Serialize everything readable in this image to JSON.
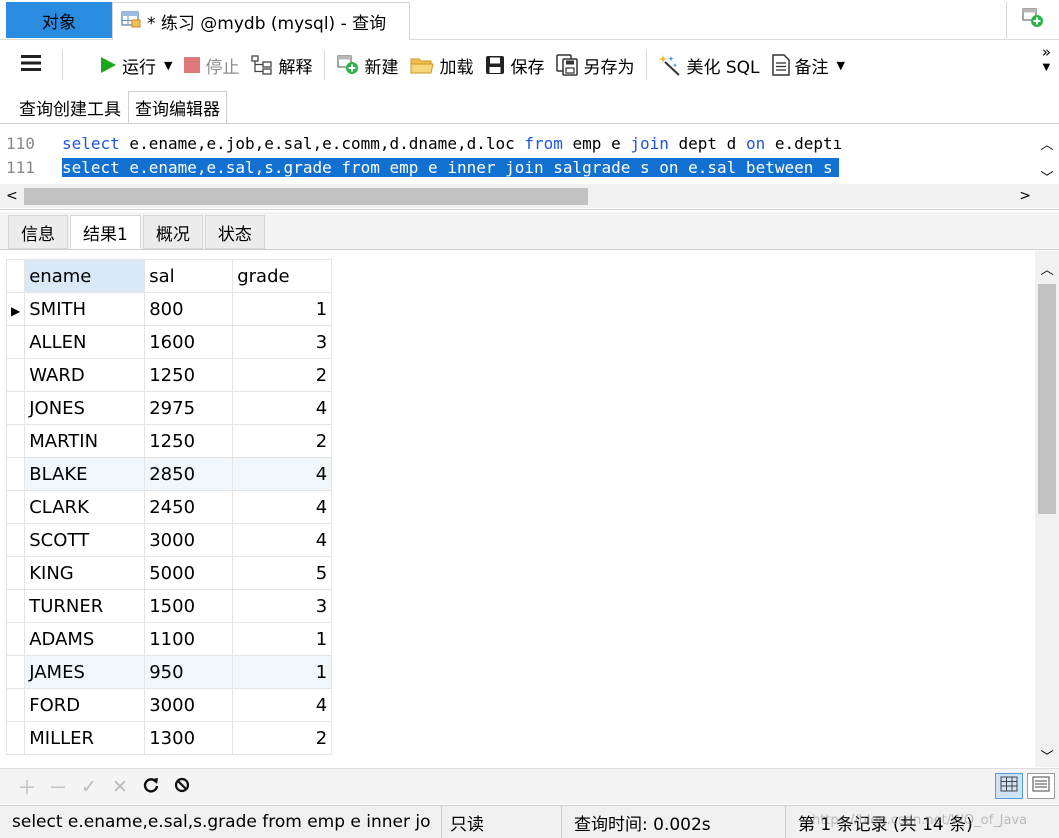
{
  "window_tabs": {
    "objects": "对象",
    "query_title": "* 练习 @mydb (mysql) - 查询"
  },
  "toolbar": {
    "run": "运行",
    "stop": "停止",
    "explain": "解释",
    "new": "新建",
    "load": "加载",
    "save": "保存",
    "save_as": "另存为",
    "beautify": "美化 SQL",
    "notes": "备注"
  },
  "sub_tabs": [
    "查询创建工具",
    "查询编辑器"
  ],
  "editor": {
    "lines": [
      {
        "num": "110",
        "parts": [
          {
            "t": "select",
            "kw": true
          },
          {
            "t": " e.ename,e.job,e.sal,e.comm,d.dname,d.loc "
          },
          {
            "t": "from",
            "kw": true
          },
          {
            "t": " emp e "
          },
          {
            "t": "join",
            "kw": true
          },
          {
            "t": " dept d "
          },
          {
            "t": "on",
            "kw": true
          },
          {
            "t": " e.deptı"
          }
        ]
      },
      {
        "num": "111",
        "text": "select e.ename,e.sal,s.grade from emp e inner join salgrade s on e.sal between s"
      }
    ]
  },
  "result_tabs": [
    "信息",
    "结果1",
    "概况",
    "状态"
  ],
  "grid": {
    "columns": [
      "ename",
      "sal",
      "grade"
    ],
    "rows": [
      [
        "SMITH",
        "800",
        "1"
      ],
      [
        "ALLEN",
        "1600",
        "3"
      ],
      [
        "WARD",
        "1250",
        "2"
      ],
      [
        "JONES",
        "2975",
        "4"
      ],
      [
        "MARTIN",
        "1250",
        "2"
      ],
      [
        "BLAKE",
        "2850",
        "4"
      ],
      [
        "CLARK",
        "2450",
        "4"
      ],
      [
        "SCOTT",
        "3000",
        "4"
      ],
      [
        "KING",
        "5000",
        "5"
      ],
      [
        "TURNER",
        "1500",
        "3"
      ],
      [
        "ADAMS",
        "1100",
        "1"
      ],
      [
        "JAMES",
        "950",
        "1"
      ],
      [
        "FORD",
        "3000",
        "4"
      ],
      [
        "MILLER",
        "1300",
        "2"
      ]
    ],
    "alt_rows": [
      5,
      11
    ]
  },
  "status": {
    "query": "select e.ename,e.sal,s.grade from emp e inner jo",
    "readonly": "只读",
    "time": "查询时间: 0.002s",
    "records": "第 1 条记录 (共 14 条)",
    "watermark": "https://blog.csdn.net/WO_of_Java"
  },
  "colors": {
    "accent": "#2a8ce0",
    "keyword": "#1f55e3",
    "selection": "#1170d0",
    "header_highlight": "#d9e9f8",
    "run_green": "#19a919",
    "stop_red": "#e07a7a"
  }
}
